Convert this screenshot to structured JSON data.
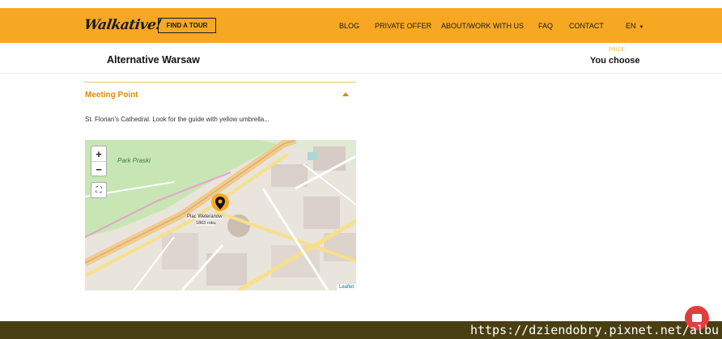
{
  "header": {
    "logo": "Walkative!",
    "find_tour": "FIND A TOUR",
    "nav": [
      {
        "label": "BLOG"
      },
      {
        "label": "PRIVATE OFFER"
      },
      {
        "label": "ABOUT/WORK WITH US"
      },
      {
        "label": "FAQ"
      },
      {
        "label": "CONTACT"
      },
      {
        "label": "EN"
      }
    ]
  },
  "tour": {
    "title": "Alternative Warsaw",
    "price_label": "PRICE:",
    "price_value": "You choose"
  },
  "meeting": {
    "heading": "Meeting Point",
    "description": "St. Florian's Cathedral. Look for the guide with yellow umbrella..."
  },
  "map": {
    "zoom_in": "+",
    "zoom_out": "−",
    "park": "Park Praski",
    "place_name": "Plac Weteranów",
    "place_distance": "1863 roku",
    "attribution": "Leaflet",
    "colors": {
      "park": "#c8e6b4",
      "road": "#f7e08a",
      "pin": "#F7A823"
    }
  },
  "footer": {
    "watermark": "https://dziendobry.pixnet.net/albu"
  },
  "colors": {
    "accent": "#F7A823",
    "heading": "#E08A00"
  }
}
